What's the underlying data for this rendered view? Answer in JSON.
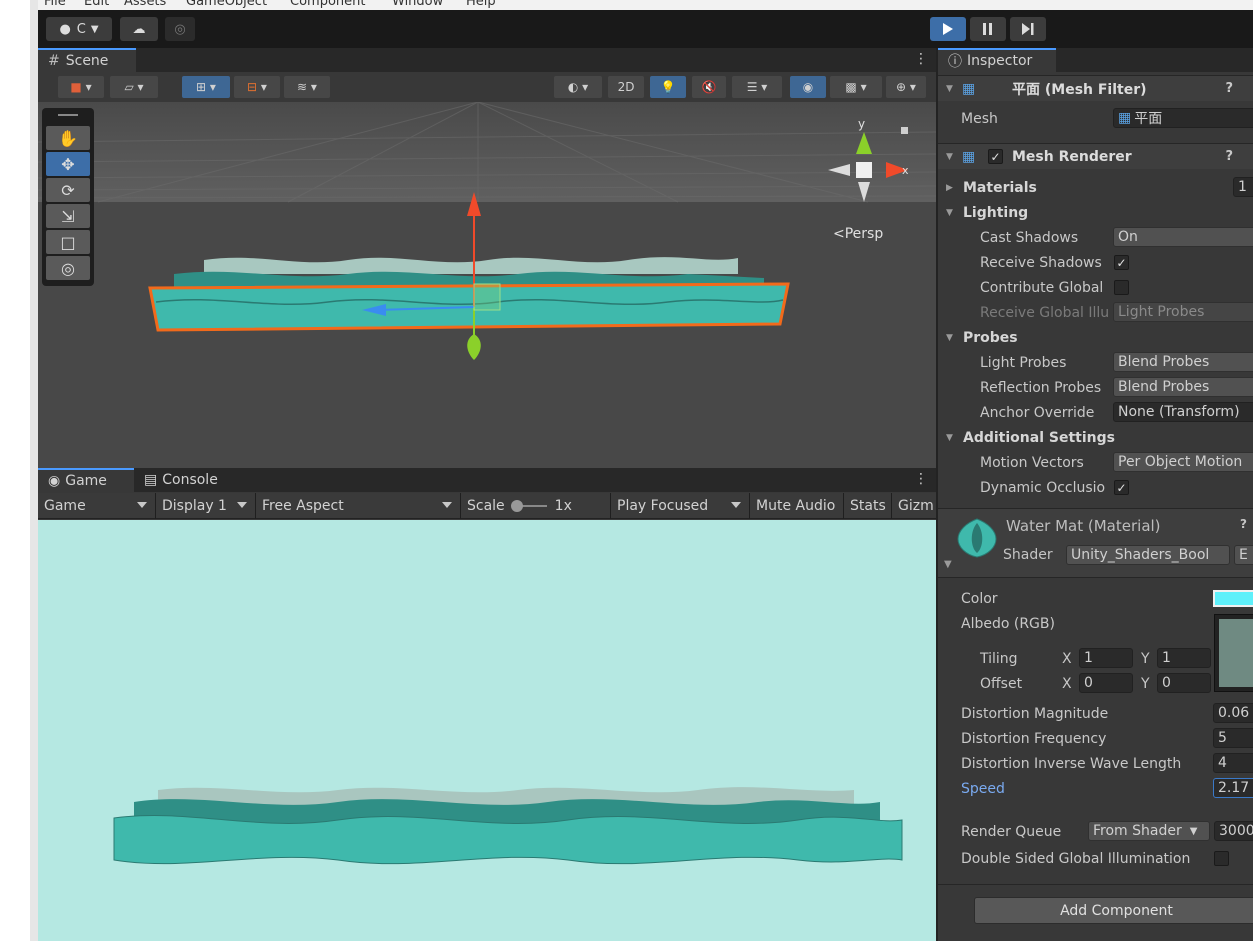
{
  "menubar": {
    "items": [
      "File",
      "Edit",
      "Assets",
      "GameObject",
      "Component",
      "Window",
      "Help"
    ]
  },
  "toolbar": {
    "account_label": "C",
    "play_icon": "play-icon",
    "pause_icon": "pause-icon",
    "step_icon": "step-icon"
  },
  "scene": {
    "tab_label": "Scene",
    "button_2d": "2D",
    "persp_label": "<Persp",
    "gizmo_y": "y",
    "gizmo_x": "x"
  },
  "game": {
    "tabs": {
      "game": "Game",
      "console": "Console"
    },
    "toolbar": {
      "mode": "Game",
      "display": "Display 1",
      "aspect": "Free Aspect",
      "scale_label": "Scale",
      "scale_value": "1x",
      "play_focused": "Play Focused",
      "mute_audio": "Mute Audio",
      "stats": "Stats",
      "gizmos": "Gizm"
    }
  },
  "inspector": {
    "tab_label": "Inspector",
    "mesh_filter": {
      "title": "平面 (Mesh Filter)",
      "mesh_label": "Mesh",
      "mesh_value": "平面"
    },
    "mesh_renderer": {
      "title": "Mesh Renderer",
      "materials_label": "Materials",
      "materials_count": "1",
      "lighting_label": "Lighting",
      "cast_shadows_label": "Cast Shadows",
      "cast_shadows_value": "On",
      "receive_shadows_label": "Receive Shadows",
      "contribute_global_label": "Contribute Global",
      "receive_global_label": "Receive Global Illu",
      "receive_global_value": "Light Probes",
      "probes_label": "Probes",
      "light_probes_label": "Light Probes",
      "light_probes_value": "Blend Probes",
      "reflection_probes_label": "Reflection Probes",
      "reflection_probes_value": "Blend Probes",
      "anchor_override_label": "Anchor Override",
      "anchor_override_value": "None (Transform)",
      "additional_settings_label": "Additional Settings",
      "motion_vectors_label": "Motion Vectors",
      "motion_vectors_value": "Per Object Motion",
      "dynamic_occlusion_label": "Dynamic Occlusio"
    },
    "material": {
      "title": "Water Mat (Material)",
      "shader_label": "Shader",
      "shader_value": "Unity_Shaders_Bool",
      "edit_label": "E",
      "color_label": "Color",
      "color_swatch": "#5ef0fa",
      "albedo_label": "Albedo (RGB)",
      "tiling_label": "Tiling",
      "tiling_x": "1",
      "tiling_y": "1",
      "offset_label": "Offset",
      "offset_x": "0",
      "offset_y": "0",
      "x_label": "X",
      "y_label": "Y",
      "distortion_magnitude_label": "Distortion Magnitude",
      "distortion_magnitude_value": "0.06",
      "distortion_frequency_label": "Distortion Frequency",
      "distortion_frequency_value": "5",
      "distortion_wavelength_label": "Distortion Inverse Wave Length",
      "distortion_wavelength_value": "4",
      "speed_label": "Speed",
      "speed_value": "2.17",
      "render_queue_label": "Render Queue",
      "render_queue_mode": "From Shader",
      "render_queue_value": "3000",
      "double_sided_label": "Double Sided Global Illumination"
    },
    "add_component": "Add Component"
  },
  "colors": {
    "accent": "#3d6ea8",
    "selection_outline": "#f26a1b",
    "water": "#3fb9ac",
    "game_background": "#b5e8e2"
  }
}
